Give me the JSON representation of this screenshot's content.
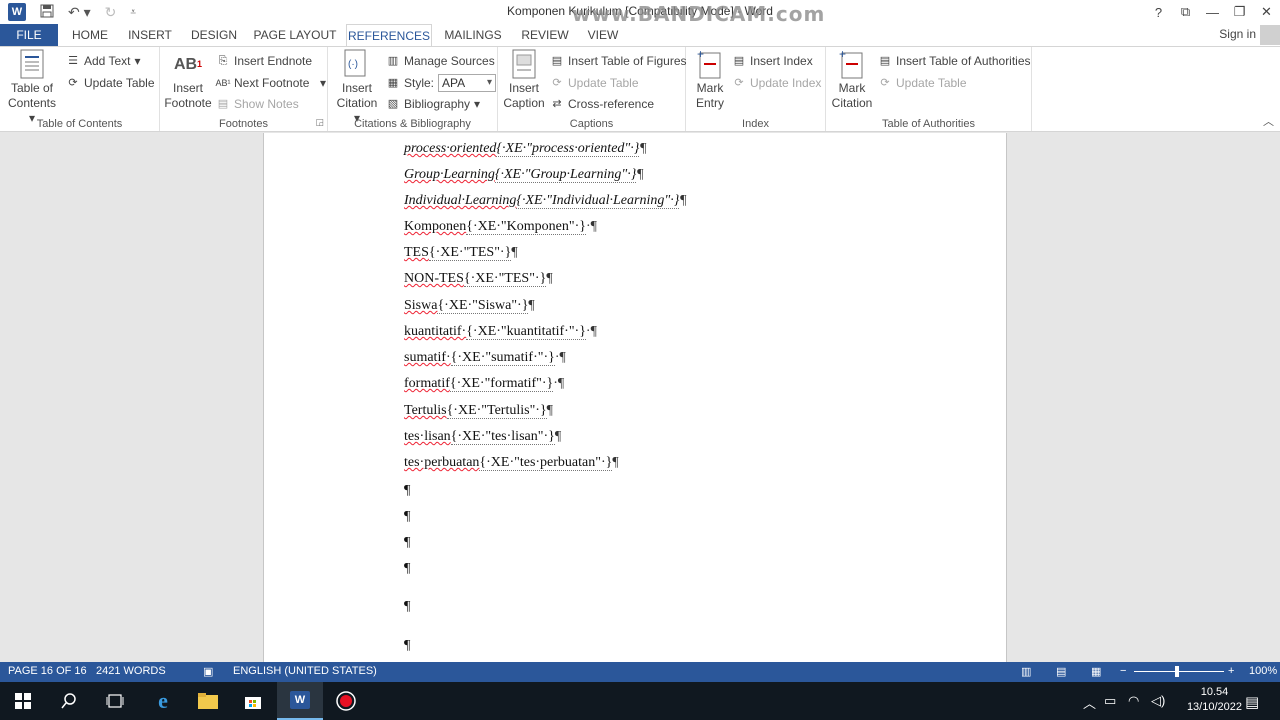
{
  "window": {
    "title": "Komponen Kurikulum [Compatibility Mode] - Word",
    "watermark": "www.BANDICAM.com",
    "controls": [
      "?",
      "❐",
      "—",
      "❐",
      "✕"
    ]
  },
  "tabs": [
    {
      "label": "FILE",
      "active": false
    },
    {
      "label": "HOME",
      "active": false
    },
    {
      "label": "INSERT",
      "active": false
    },
    {
      "label": "DESIGN",
      "active": false
    },
    {
      "label": "PAGE LAYOUT",
      "active": false
    },
    {
      "label": "REFERENCES",
      "active": true
    },
    {
      "label": "MAILINGS",
      "active": false
    },
    {
      "label": "REVIEW",
      "active": false
    },
    {
      "label": "VIEW",
      "active": false
    }
  ],
  "signin": "Sign in",
  "ribbon": {
    "toc": {
      "label": "Table of Contents",
      "big_line1": "Table of",
      "big_line2": "Contents",
      "add_text": "Add Text",
      "update_table": "Update Table"
    },
    "footnotes": {
      "label": "Footnotes",
      "insert_line1": "Insert",
      "insert_line2": "Footnote",
      "insert_endnote": "Insert Endnote",
      "next_footnote": "Next Footnote",
      "show_notes": "Show Notes"
    },
    "citations": {
      "label": "Citations & Bibliography",
      "insert_line1": "Insert",
      "insert_line2": "Citation",
      "manage_sources": "Manage Sources",
      "style_label": "Style:",
      "style_value": "APA",
      "bibliography": "Bibliography"
    },
    "captions": {
      "label": "Captions",
      "insert_line1": "Insert",
      "insert_line2": "Caption",
      "insert_tof": "Insert Table of Figures",
      "update_table": "Update Table",
      "cross_reference": "Cross-reference"
    },
    "index": {
      "label": "Index",
      "mark_line1": "Mark",
      "mark_line2": "Entry",
      "insert_index": "Insert Index",
      "update_index": "Update Index"
    },
    "toa": {
      "label": "Table of Authorities",
      "mark_line1": "Mark",
      "mark_line2": "Citation",
      "insert_toa": "Insert Table of Authorities",
      "update_table": "Update Table"
    }
  },
  "document": {
    "lines": [
      {
        "word": "process·oriented",
        "xe": "{·XE·\"process·oriented\"·}",
        "tail": "¶",
        "italic": true
      },
      {
        "word": "Group·Learning",
        "xe": "{·XE·\"Group·Learning\"·}",
        "tail": "¶",
        "italic": true
      },
      {
        "word": "Individual·Learning",
        "xe": "{·XE·\"Individual·Learning\"·}",
        "tail": "¶",
        "italic": true
      },
      {
        "word": "Komponen",
        "xe": "{·XE·\"Komponen\"·}",
        "tail": "·¶",
        "italic": false
      },
      {
        "word": "TES",
        "xe": "{·XE·\"TES\"·}",
        "tail": "¶",
        "italic": false
      },
      {
        "word": "NON-TES",
        "xe": "{·XE·\"TES\"·}",
        "tail": "¶",
        "italic": false
      },
      {
        "word": "Siswa",
        "xe": "{·XE·\"Siswa\"·}",
        "tail": "¶",
        "italic": false
      },
      {
        "word": "kuantitatif·",
        "xe": "{·XE·\"kuantitatif·\"·}",
        "tail": "·¶",
        "italic": false
      },
      {
        "word": "sumatif·",
        "xe": "{·XE·\"sumatif·\"·}",
        "tail": "·¶",
        "italic": false
      },
      {
        "word": "formatif",
        "xe": "{·XE·\"formatif\"·}",
        "tail": "·¶",
        "italic": false
      },
      {
        "word": "Tertulis",
        "xe": "{·XE·\"Tertulis\"·}",
        "tail": "¶",
        "italic": false
      },
      {
        "word": "tes·lisan",
        "xe": "{·XE·\"tes·lisan\"·}",
        "tail": "¶",
        "italic": false
      },
      {
        "word": "tes·perbuatan",
        "xe": "{·XE·\"tes·perbuatan\"·}",
        "tail": "¶",
        "italic": false
      }
    ],
    "empty_paragraph": "¶"
  },
  "status": {
    "page": "PAGE 16 OF 16",
    "words": "2421 WORDS",
    "language": "ENGLISH (UNITED STATES)",
    "zoom_minus": "−",
    "zoom_plus": "+",
    "zoom": "100%"
  },
  "taskbar": {
    "time": "10.54",
    "date": "13/10/2022"
  },
  "colors": {
    "accent": "#2b579a",
    "spellcheck": "#e23"
  }
}
